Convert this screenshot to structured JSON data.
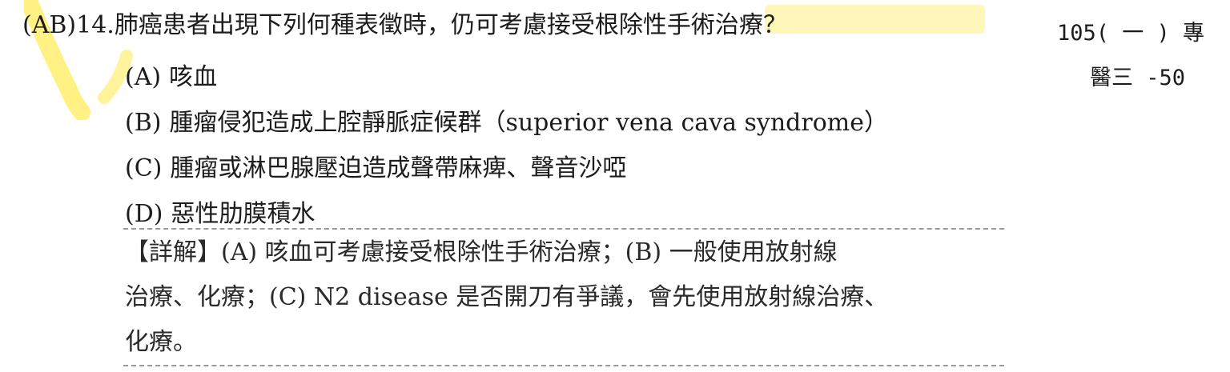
{
  "question": {
    "answer": "(AB)",
    "number": "14.",
    "text": "肺癌患者出現下列何種表徵時，仍可考慮接受根除性手術治療？"
  },
  "source": {
    "line1": "105( 一 ) 專",
    "line2": "醫三 -50"
  },
  "options": [
    {
      "key": "(A)",
      "text": "咳血"
    },
    {
      "key": "(B)",
      "text": "腫瘤侵犯造成上腔靜脈症候群（superior vena cava syndrome）"
    },
    {
      "key": "(C)",
      "text": "腫瘤或淋巴腺壓迫造成聲帶麻痺、聲音沙啞"
    },
    {
      "key": "(D)",
      "text": "惡性肋膜積水"
    }
  ],
  "explanation": {
    "lines": [
      "【詳解】(A) 咳血可考慮接受根除性手術治療；(B) 一般使用放射線",
      "治療、化療；(C) N2 disease 是否開刀有爭議，會先使用放射線治療、",
      "化療。"
    ]
  },
  "colors": {
    "highlight": "#FFEC5A",
    "text": "#1C1C1C",
    "divider": "#9A9A9A"
  }
}
